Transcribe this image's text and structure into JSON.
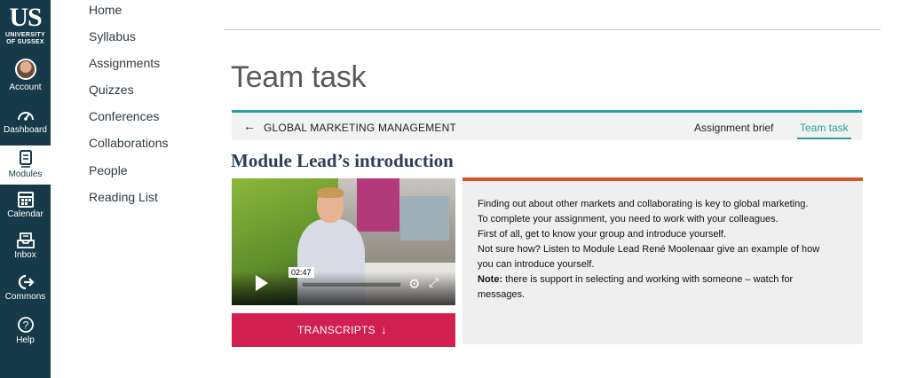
{
  "global_nav": {
    "logo_main": "US",
    "logo_line1": "UNIVERSITY",
    "logo_line2": "OF SUSSEX",
    "items": [
      {
        "label": "Account",
        "icon": "avatar"
      },
      {
        "label": "Dashboard",
        "icon": "dashboard-icon"
      },
      {
        "label": "Modules",
        "icon": "modules-icon",
        "active": true
      },
      {
        "label": "Calendar",
        "icon": "calendar-icon"
      },
      {
        "label": "Inbox",
        "icon": "inbox-icon"
      },
      {
        "label": "Commons",
        "icon": "commons-icon"
      },
      {
        "label": "Help",
        "icon": "help-icon"
      }
    ]
  },
  "course_nav": {
    "items": [
      "Home",
      "Syllabus",
      "Assignments",
      "Quizzes",
      "Conferences",
      "Collaborations",
      "People",
      "Reading List"
    ]
  },
  "page": {
    "title": "Team task"
  },
  "breadcrumb_bar": {
    "back_icon": "arrow-left-icon",
    "course_name": "GLOBAL MARKETING MANAGEMENT",
    "tabs": [
      {
        "label": "Assignment brief",
        "active": false
      },
      {
        "label": "Team task",
        "active": true
      }
    ]
  },
  "section": {
    "heading": "Module Lead’s introduction"
  },
  "video": {
    "time": "02:47"
  },
  "transcripts": {
    "label": "TRANSCRIPTS",
    "icon": "arrow-down-icon"
  },
  "panel": {
    "lines": [
      "Finding out about other markets and collaborating is key to global marketing.",
      "To complete your assignment, you need to work with your colleagues.",
      "First of all, get to know your group and introduce yourself.",
      "Not sure how? Listen to Module Lead René Moolenaar give an example of how",
      "you can introduce yourself."
    ],
    "note_label": "Note:",
    "note_text": " there is support in selecting and working with someone – watch for",
    "note_text_2": "messages."
  },
  "colors": {
    "nav_bg": "#163a49",
    "accent_teal": "#2aa0a2",
    "accent_orange": "#d9542b",
    "button_red": "#d11f50"
  }
}
